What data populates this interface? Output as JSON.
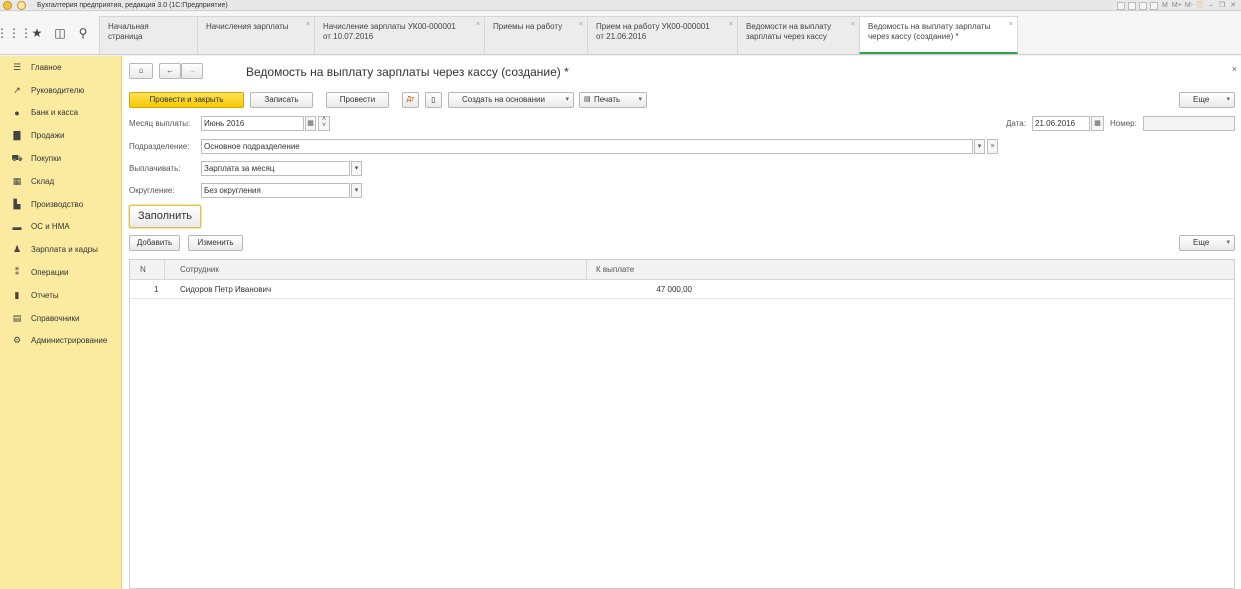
{
  "app": {
    "title": "Бухгалтерия предприятия, редакция 3.0  (1С:Предприятие)",
    "title_tools": [
      "M",
      "M+",
      "M-"
    ]
  },
  "toolbar_icons": [
    "grid-icon",
    "star-icon",
    "history-icon",
    "search-icon"
  ],
  "tabs": [
    {
      "line1": "Начальная страница",
      "line2": "",
      "closable": false,
      "active": false
    },
    {
      "line1": "Начисления зарплаты",
      "line2": "",
      "closable": true,
      "active": false
    },
    {
      "line1": "Начисление зарплаты УК00-000001",
      "line2": "от 10.07.2016",
      "closable": true,
      "active": false
    },
    {
      "line1": "Приемы на работу",
      "line2": "",
      "closable": true,
      "active": false
    },
    {
      "line1": "Прием на работу УК00-000001",
      "line2": "от 21.06.2016",
      "closable": true,
      "active": false
    },
    {
      "line1": "Ведомости на выплату",
      "line2": "зарплаты через кассу",
      "closable": true,
      "active": false
    },
    {
      "line1": "Ведомость на выплату зарплаты",
      "line2": "через кассу (создание) *",
      "closable": true,
      "active": true
    }
  ],
  "sidebar": {
    "items": [
      {
        "label": "Главное",
        "icon": "menu-lines-icon"
      },
      {
        "label": "Руководителю",
        "icon": "trend-icon"
      },
      {
        "label": "Банк и касса",
        "icon": "bank-icon"
      },
      {
        "label": "Продажи",
        "icon": "bag-icon"
      },
      {
        "label": "Покупки",
        "icon": "cart-icon"
      },
      {
        "label": "Склад",
        "icon": "warehouse-icon"
      },
      {
        "label": "Производство",
        "icon": "factory-icon"
      },
      {
        "label": "ОС и НМА",
        "icon": "truck-icon"
      },
      {
        "label": "Зарплата и кадры",
        "icon": "person-icon"
      },
      {
        "label": "Операции",
        "icon": "operations-icon"
      },
      {
        "label": "Отчеты",
        "icon": "chart-icon"
      },
      {
        "label": "Справочники",
        "icon": "book-icon"
      },
      {
        "label": "Администрирование",
        "icon": "gear-icon"
      }
    ]
  },
  "doc": {
    "title": "Ведомость на выплату зарплаты через кассу (создание) *",
    "close": "×",
    "commands": {
      "post_close": "Провести и закрыть",
      "save": "Записать",
      "post": "Провести",
      "create_based": "Создать на основании",
      "print": "Печать",
      "more": "Еще"
    },
    "fields": {
      "month_label": "Месяц выплаты:",
      "month_value": "Июнь 2016",
      "date_label": "Дата:",
      "date_value": "21.06.2016",
      "number_label": "Номер:",
      "number_value": "",
      "division_label": "Подразделение:",
      "division_value": "Основное подразделение",
      "pay_label": "Выплачивать:",
      "pay_value": "Зарплата за месяц",
      "rounding_label": "Округление:",
      "rounding_value": "Без округления"
    },
    "fill_button": "Заполнить",
    "table_commands": {
      "add": "Добавить",
      "edit": "Изменить",
      "more": "Еще"
    },
    "table": {
      "columns": [
        "N",
        "Сотрудник",
        "К выплате"
      ],
      "rows": [
        {
          "n": "1",
          "employee": "Сидоров Петр Иванович",
          "amount": "47 000,00"
        }
      ]
    }
  },
  "colors": {
    "sidebar_bg": "#fbeba0",
    "primary_button": "#f5c800",
    "active_tab_accent": "#2fa34a"
  }
}
